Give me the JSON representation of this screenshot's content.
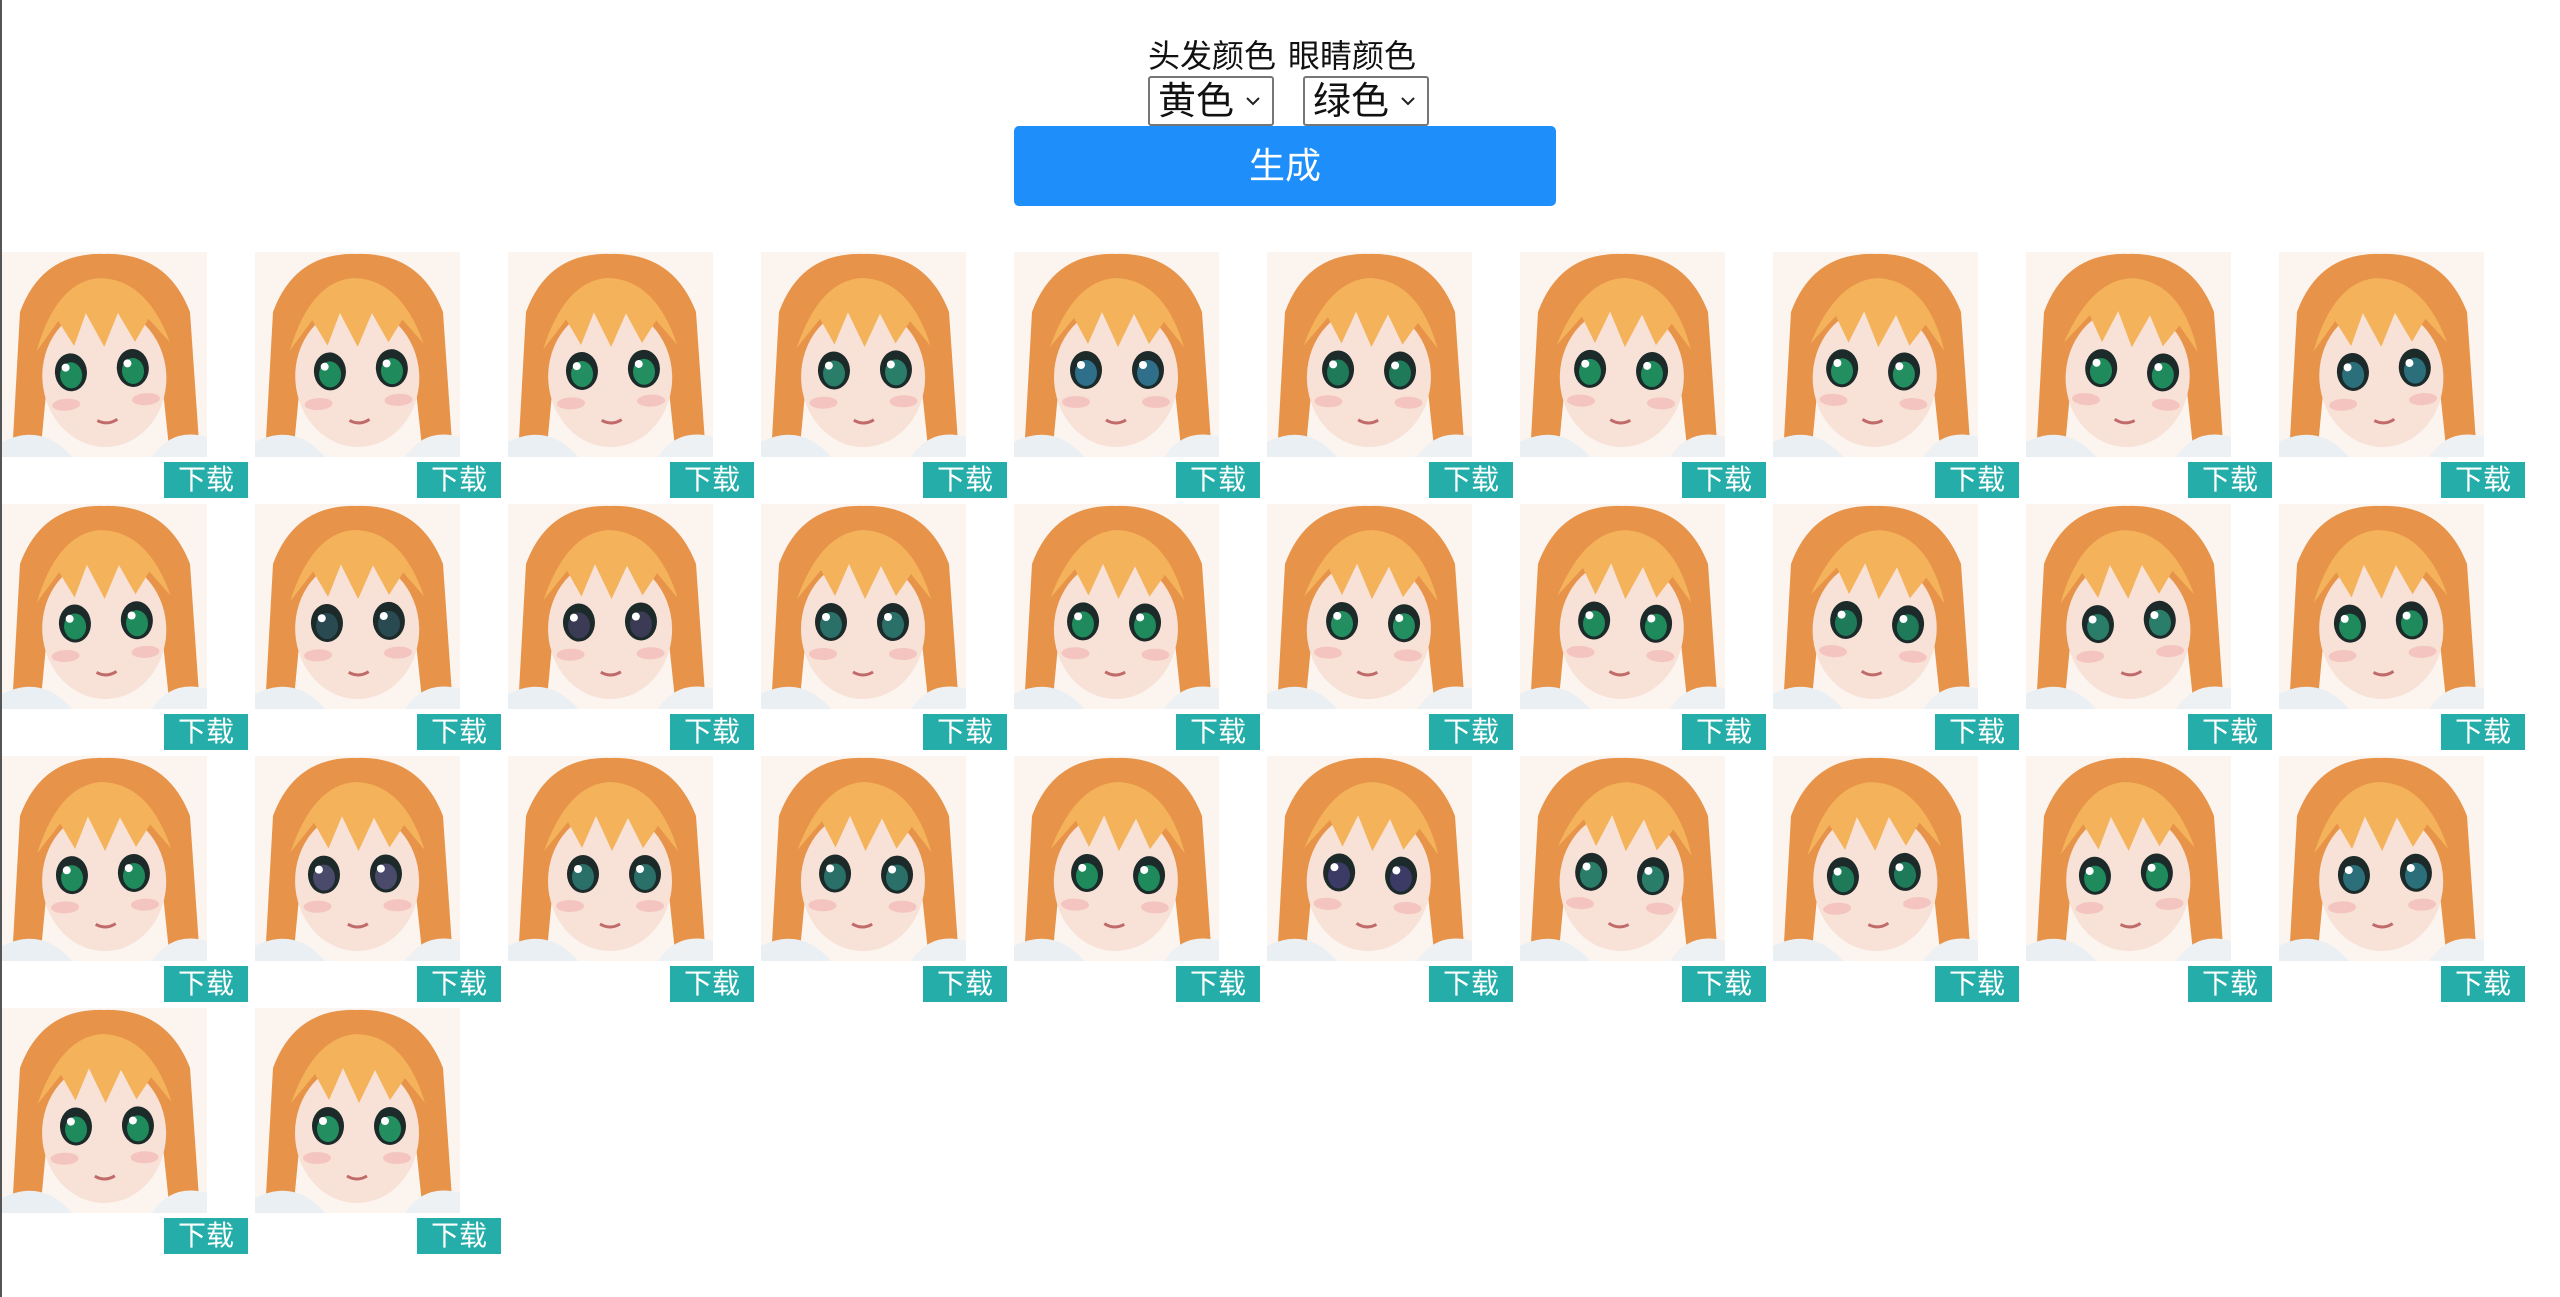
{
  "form": {
    "hair_label": "头发颜色",
    "eye_label": "眼睛颜色",
    "hair_value": "黄色",
    "eye_value": "绿色",
    "generate_label": "生成"
  },
  "download_label": "下载",
  "results": [
    {
      "eye_color": "#1f8a5c"
    },
    {
      "eye_color": "#1f8a5c"
    },
    {
      "eye_color": "#238f60"
    },
    {
      "eye_color": "#2a7d68"
    },
    {
      "eye_color": "#2f6f8a"
    },
    {
      "eye_color": "#1f7a5a"
    },
    {
      "eye_color": "#1f8a5c"
    },
    {
      "eye_color": "#238f60"
    },
    {
      "eye_color": "#1f8a5c"
    },
    {
      "eye_color": "#2a6f7a"
    },
    {
      "eye_color": "#1f8a5c"
    },
    {
      "eye_color": "#2a4a52"
    },
    {
      "eye_color": "#3b3b55"
    },
    {
      "eye_color": "#2a6f68"
    },
    {
      "eye_color": "#1f8a5c"
    },
    {
      "eye_color": "#238f60"
    },
    {
      "eye_color": "#1f8a5c"
    },
    {
      "eye_color": "#1f7a5a"
    },
    {
      "eye_color": "#2a7d68"
    },
    {
      "eye_color": "#1f8a5c"
    },
    {
      "eye_color": "#1f8a5c"
    },
    {
      "eye_color": "#4a4a6a"
    },
    {
      "eye_color": "#2a6f68"
    },
    {
      "eye_color": "#2a6f68"
    },
    {
      "eye_color": "#1f8a5c"
    },
    {
      "eye_color": "#3b3b66"
    },
    {
      "eye_color": "#2a7d68"
    },
    {
      "eye_color": "#1f7a5a"
    },
    {
      "eye_color": "#1f8a5c"
    },
    {
      "eye_color": "#2a6f7a"
    },
    {
      "eye_color": "#1f8a5c"
    },
    {
      "eye_color": "#238f60"
    }
  ],
  "colors": {
    "accent": "#1e8ffa",
    "download_bg": "#24ada9",
    "hair": "#e7944a",
    "hair_highlight": "#f4b25a",
    "skin": "#f8e1d6"
  }
}
